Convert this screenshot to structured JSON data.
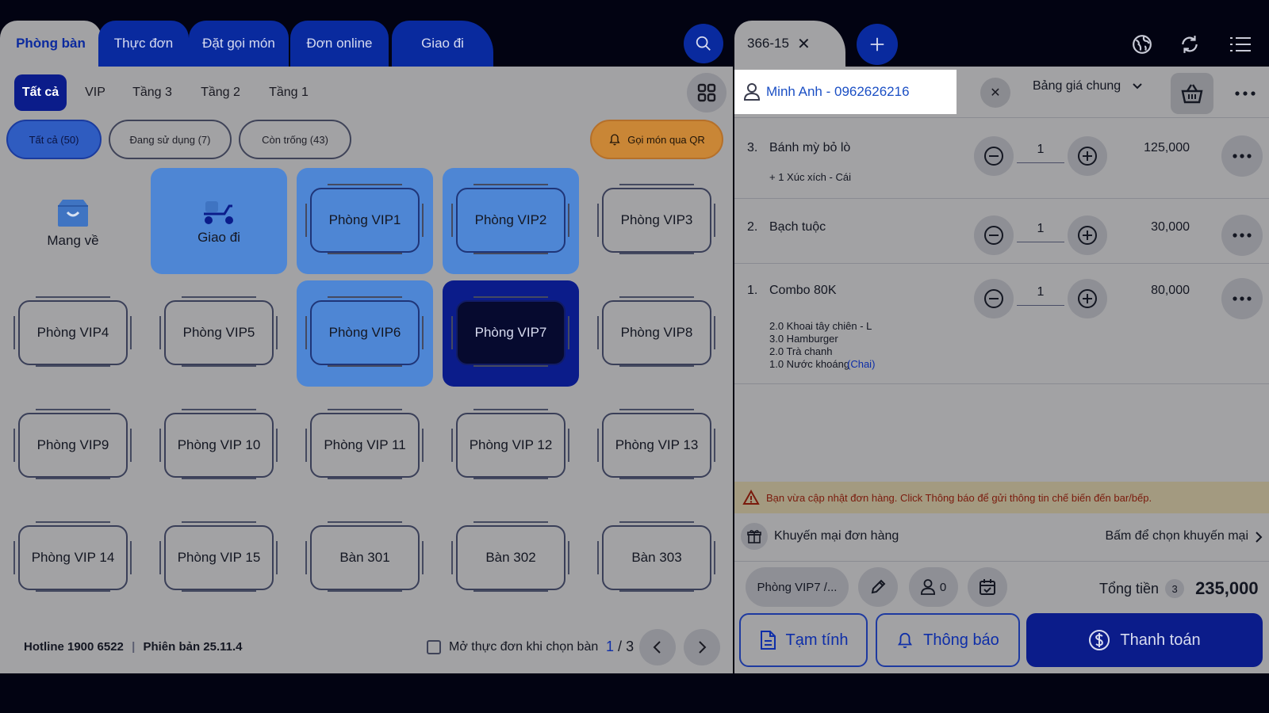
{
  "top_tabs": [
    "Phòng bàn",
    "Thực đơn",
    "Đặt gọi món",
    "Đơn online",
    "Giao đi"
  ],
  "order_tab": {
    "label": "366-15"
  },
  "floor_tabs": [
    "Tất cả",
    "VIP",
    "Tầng 3",
    "Tầng 2",
    "Tầng 1"
  ],
  "filters": {
    "all": "Tất cả (50)",
    "in_use": "Đang sử dụng (7)",
    "free": "Còn trống (43)",
    "qr": "Gọi món qua QR"
  },
  "takeaway": "Mang về",
  "delivery": "Giao đi",
  "rooms": [
    "Phòng VIP1",
    "Phòng VIP2",
    "Phòng VIP3",
    "Phòng VIP4",
    "Phòng VIP5",
    "Phòng VIP6",
    "Phòng VIP7",
    "Phòng VIP8",
    "Phòng VIP9",
    "Phòng VIP 10",
    "Phòng VIP 11",
    "Phòng VIP 12",
    "Phòng VIP 13",
    "Phòng VIP 14",
    "Phòng VIP 15",
    "Bàn 301",
    "Bàn 302",
    "Bàn 303"
  ],
  "footer": {
    "hotline": "Hotline 1900 6522",
    "version": "Phiên bản 25.11.4",
    "open_menu": "Mở thực đơn khi chọn bàn",
    "page_current": "1",
    "page_sep": "/",
    "page_total": "3"
  },
  "customer": "Minh Anh - 0962626216",
  "price_list": "Bảng giá chung",
  "items": [
    {
      "index": "3.",
      "name": "Bánh mỳ bỏ lò",
      "qty": "1",
      "price": "125,000",
      "notes": [
        "+ 1 Xúc xích - Cái"
      ]
    },
    {
      "index": "2.",
      "name": "Bạch tuộc",
      "qty": "1",
      "price": "30,000",
      "notes": []
    },
    {
      "index": "1.",
      "name": "Combo 80K",
      "qty": "1",
      "price": "80,000",
      "notes": [
        "2.0 Khoai tây chiên - L",
        "3.0 Hamburger",
        "2.0 Trà chanh",
        "1.0 Nước khoáng"
      ],
      "note_unit": "(Chai)"
    }
  ],
  "warning": "Bạn vừa cập nhật đơn hàng. Click Thông báo để gửi thông tin chế biến đến bar/bếp.",
  "promo": {
    "label": "Khuyến mại đơn hàng",
    "action": "Bấm để chọn khuyến mại"
  },
  "summary": {
    "room": "Phòng VIP7 /...",
    "guests": "0",
    "total_label": "Tổng tiền",
    "total_count": "3",
    "total": "235,000"
  },
  "actions": {
    "provisional": "Tạm tính",
    "notify": "Thông báo",
    "pay": "Thanh toán"
  },
  "colors": {
    "primary": "#0b1c8a",
    "accent": "#1b4fc4",
    "highlight": "#4e86d4",
    "qr": "#c98636"
  }
}
